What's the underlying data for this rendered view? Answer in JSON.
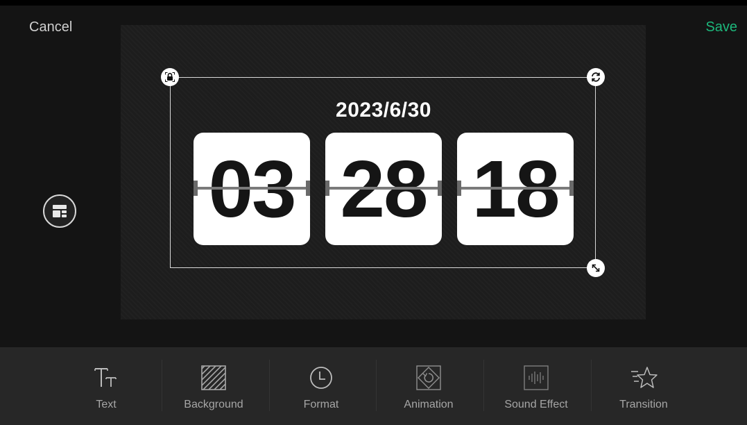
{
  "header": {
    "cancel_label": "Cancel",
    "save_label": "Save"
  },
  "clock": {
    "date": "2023/6/30",
    "hours": "03",
    "minutes": "28",
    "seconds": "18"
  },
  "toolbar": {
    "items": [
      {
        "label": "Text",
        "icon": "text-icon"
      },
      {
        "label": "Background",
        "icon": "background-pattern-icon"
      },
      {
        "label": "Format",
        "icon": "clock-icon"
      },
      {
        "label": "Animation",
        "icon": "animation-icon"
      },
      {
        "label": "Sound Effect",
        "icon": "sound-wave-icon"
      },
      {
        "label": "Transition",
        "icon": "star-icon"
      }
    ]
  },
  "colors": {
    "accent": "#1db87c",
    "background": "#141414",
    "toolbar": "#272727",
    "card": "#ffffff"
  }
}
